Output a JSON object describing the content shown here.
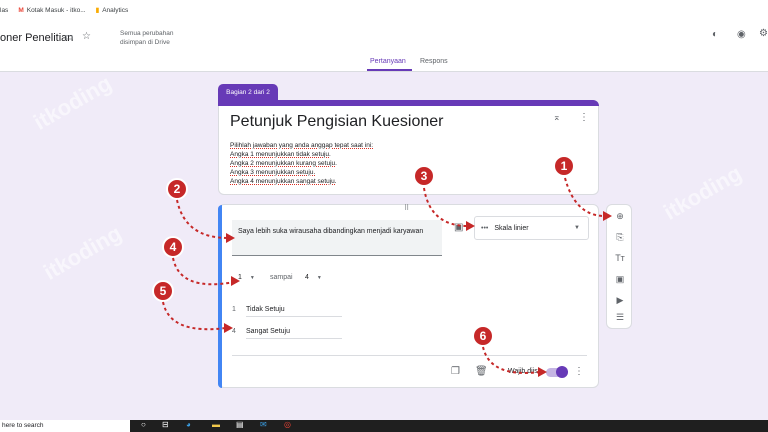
{
  "bookmarks": [
    {
      "label": "las",
      "icon": "folder-icon"
    },
    {
      "label": "Kotak Masuk - itko...",
      "icon": "gmail-icon"
    },
    {
      "label": "Analytics",
      "icon": "analytics-icon"
    }
  ],
  "header": {
    "form_title": "oner Penelitian",
    "saved_text": "Semua perubahan disimpan di Drive",
    "tabs": [
      "Pertanyaan",
      "Respons"
    ]
  },
  "section": {
    "badge": "Bagian 2 dari 2",
    "title": "Petunjuk Pengisian Kuesioner",
    "description": [
      "Pilihlah jawaban yang anda anggap tepat saat ini:",
      "Angka 1 menunjukkan tidak setuju.",
      "Angka 2 menunjukkan kurang setuju.",
      "Angka 3 menunjukkan setuju.",
      "Angka 4 menunjukkan sangat setuju."
    ]
  },
  "question": {
    "text": "Saya lebih suka wirausaha dibandingkan menjadi karyawan",
    "type": "Skala linier",
    "from": "1",
    "to_label": "sampai",
    "to": "4",
    "label1_num": "1",
    "label1": "Tidak Setuju",
    "label2_num": "4",
    "label2": "Sangat Setuju",
    "required_label": "Wajib diisi"
  },
  "markers": [
    "1",
    "2",
    "3",
    "4",
    "5",
    "6"
  ],
  "watermark": "itkoding",
  "taskbar": {
    "search": "here to search"
  },
  "colors": {
    "accent": "#673ab7",
    "marker": "#c62828",
    "question_border": "#4285f4"
  }
}
